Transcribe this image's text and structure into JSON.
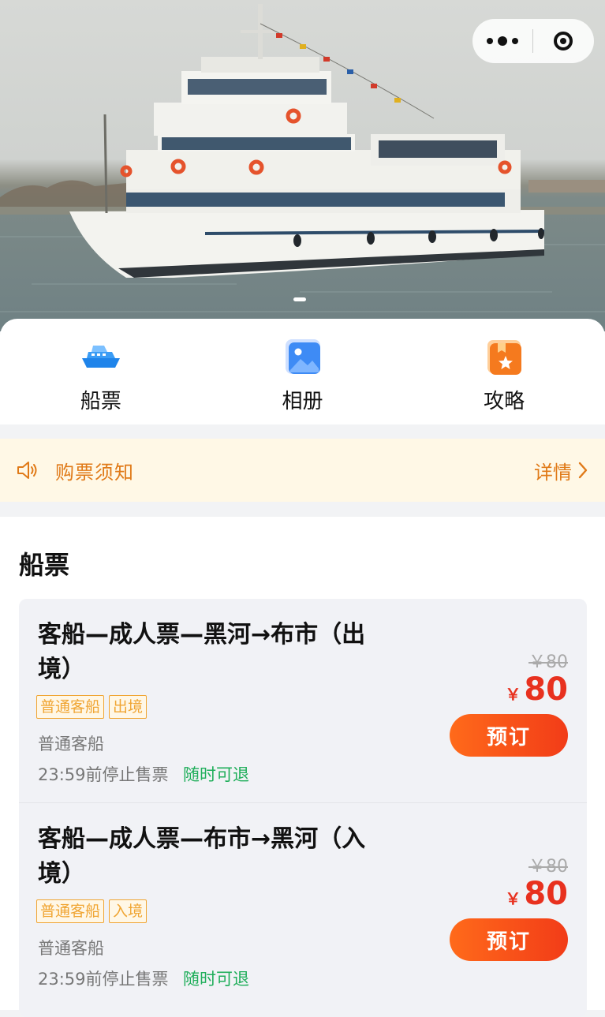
{
  "hero": {
    "image_alt": "white passenger ferry on river",
    "carousel_pages": 1,
    "carousel_active": 1
  },
  "capsule": {
    "more_icon": "more-dots-icon",
    "close_icon": "target-icon"
  },
  "nav": [
    {
      "label": "船票",
      "icon": "ship-icon",
      "color": "#2b8ff0"
    },
    {
      "label": "相册",
      "icon": "photo-album-icon",
      "color": "#3e8bf5"
    },
    {
      "label": "攻略",
      "icon": "guide-star-icon",
      "color": "#f57a1e"
    }
  ],
  "notice": {
    "icon": "speaker-icon",
    "text": "购票须知",
    "detail": "详情"
  },
  "tickets_section": {
    "title": "船票",
    "items": [
      {
        "name": "客船—成人票—黑河→布市（出境）",
        "tags": [
          "普通客船",
          "出境"
        ],
        "type": "普通客船",
        "stop_sale": "23:59前停止售票",
        "refund": "随时可退",
        "original_price": "￥80",
        "currency": "￥",
        "price": "80",
        "button": "预订"
      },
      {
        "name": "客船—成人票—布市→黑河（入境）",
        "tags": [
          "普通客船",
          "入境"
        ],
        "type": "普通客船",
        "stop_sale": "23:59前停止售票",
        "refund": "随时可退",
        "original_price": "￥80",
        "currency": "￥",
        "price": "80",
        "button": "预订"
      }
    ]
  },
  "colors": {
    "accent": "#e07a18",
    "price": "#e8311f",
    "refund": "#1fae5a",
    "tag": "#f0a533"
  }
}
